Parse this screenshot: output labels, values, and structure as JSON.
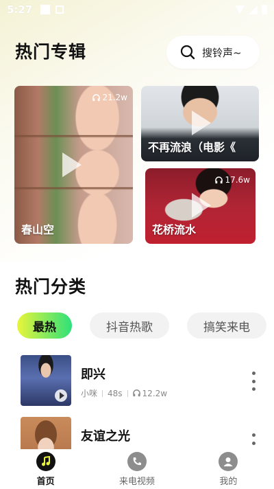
{
  "status_bar": {
    "time": "5:27"
  },
  "header": {
    "title": "热门专辑",
    "search_placeholder": "搜铃声~"
  },
  "albums": [
    {
      "name": "春山空",
      "plays": "21.2w"
    },
    {
      "name": "不再流浪（电影《",
      "plays": ""
    },
    {
      "name": "花桥流水",
      "plays": "17.6w"
    }
  ],
  "categories": {
    "title": "热门分类",
    "chips": [
      "最热",
      "抖音热歌",
      "搞笑来电"
    ],
    "active": "最热"
  },
  "songs": [
    {
      "title": "即兴",
      "artist": "小咪",
      "duration": "48s",
      "plays": "12.2w"
    },
    {
      "title": "友谊之光",
      "artist": "",
      "duration": "",
      "plays": ""
    }
  ],
  "nav": {
    "items": [
      {
        "label": "首页",
        "icon": "music-note-icon",
        "active": true
      },
      {
        "label": "来电视频",
        "icon": "phone-icon",
        "active": false
      },
      {
        "label": "我的",
        "icon": "user-icon",
        "active": false
      }
    ]
  },
  "colors": {
    "accent_start": "#e9f53a",
    "accent_end": "#2ee07a"
  }
}
